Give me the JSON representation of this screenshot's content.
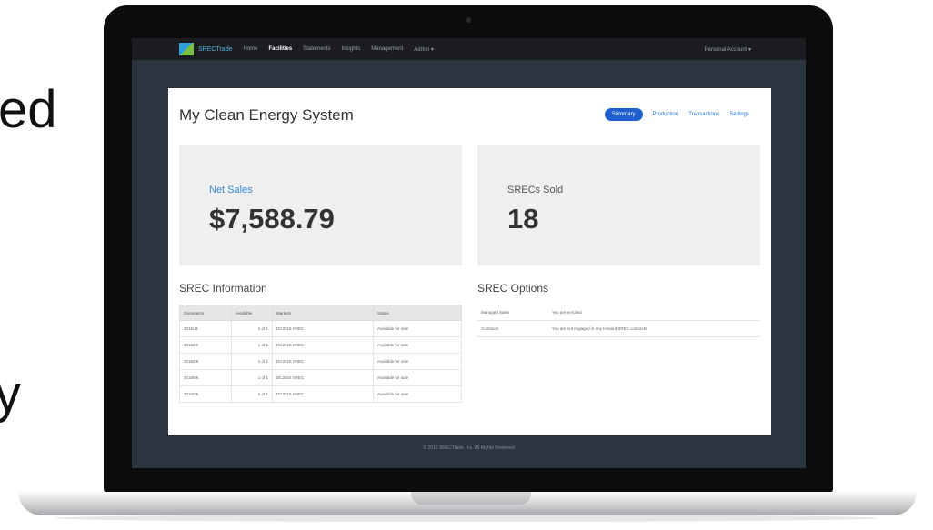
{
  "background_text": {
    "fragment_top": "ed",
    "fragment_bottom": "y"
  },
  "nav": {
    "logo_text": "SRECTrade",
    "links": [
      "Home",
      "Facilities",
      "Statements",
      "Insights",
      "Management",
      "Admin ▾"
    ],
    "active_index": 1,
    "account": "Personal Account ▾"
  },
  "page": {
    "title": "My Clean Energy System",
    "tabs": [
      "Summary",
      "Production",
      "Transactions",
      "Settings"
    ],
    "active_tab": 0
  },
  "stats": {
    "net_sales_label": "Net Sales",
    "net_sales_value": "$7,588.79",
    "srecs_sold_label": "SRECs Sold",
    "srecs_sold_value": "18"
  },
  "srec_info": {
    "title": "SREC Information",
    "columns": [
      "Generation",
      "Available",
      "Markets",
      "Status"
    ],
    "rows": [
      [
        "2016/11",
        "1 of 1",
        "DC2016 SREC",
        "Available for sale"
      ],
      [
        "2016/09",
        "1 of 1",
        "DC2016 SREC",
        "Available for sale"
      ],
      [
        "2016/09",
        "1 of 1",
        "DC2016 SREC",
        "Available for sale"
      ],
      [
        "2016/06",
        "1 of 1",
        "DC2016 SREC",
        "Available for sale"
      ],
      [
        "2016/05",
        "1 of 1",
        "DC2016 SREC",
        "Available for sale"
      ]
    ]
  },
  "srec_options": {
    "title": "SREC Options",
    "rows": [
      [
        "Managed Sales",
        "You are enrolled"
      ],
      [
        "Contracts",
        "You are not engaged in any forward SREC contracts"
      ]
    ]
  },
  "footer": "© 2016 SRECTrade, Inc. All Rights Reserved",
  "colors": {
    "navbar": "#1b1d20",
    "screen_bg": "#2c3440",
    "accent": "#1f5fcf",
    "link": "#2a7ad8"
  }
}
